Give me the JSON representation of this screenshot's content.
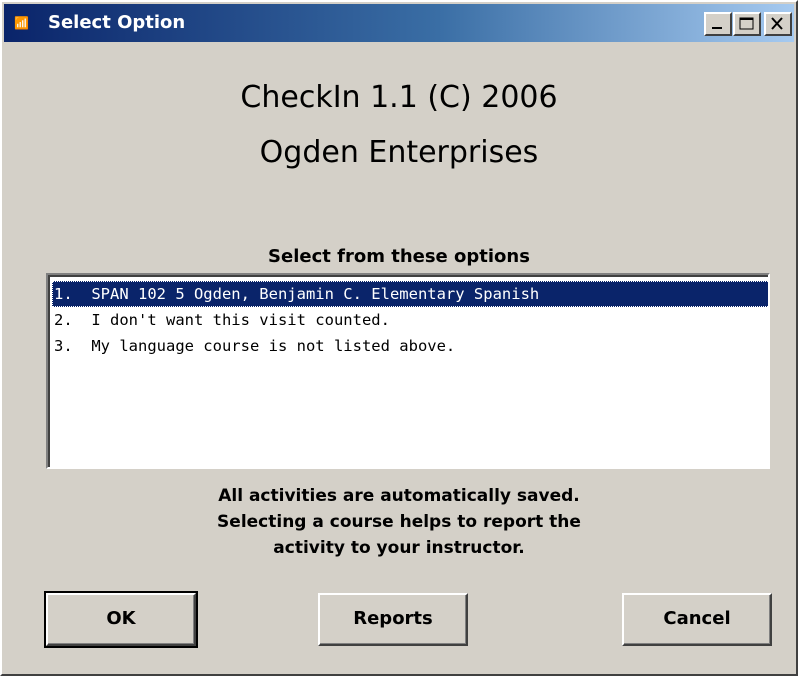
{
  "window": {
    "title": "Select Option",
    "icon": "app-icon",
    "controls": [
      "minimize-icon",
      "maximize-icon",
      "close-icon"
    ]
  },
  "header": {
    "line1": "CheckIn 1.1  (C) 2006",
    "line2": "Ogden Enterprises"
  },
  "options_label": "Select from these options",
  "options": [
    {
      "text": "1.  SPAN 102 5 Ogden, Benjamin C. Elementary Spanish",
      "selected": true
    },
    {
      "text": "2.  I don't want this visit counted.",
      "selected": false
    },
    {
      "text": "3.  My language course is not listed above.",
      "selected": false
    }
  ],
  "info": {
    "line1": "All activities are automatically saved.",
    "line2": "Selecting a course helps to report the",
    "line3": "activity to your instructor."
  },
  "buttons": {
    "ok": "OK",
    "reports": "Reports",
    "cancel": "Cancel"
  },
  "colors": {
    "titlebar_start": "#0a246a",
    "titlebar_end": "#a6caf0",
    "dialog_bg": "#d4d0c8",
    "selection_bg": "#0a246a"
  }
}
